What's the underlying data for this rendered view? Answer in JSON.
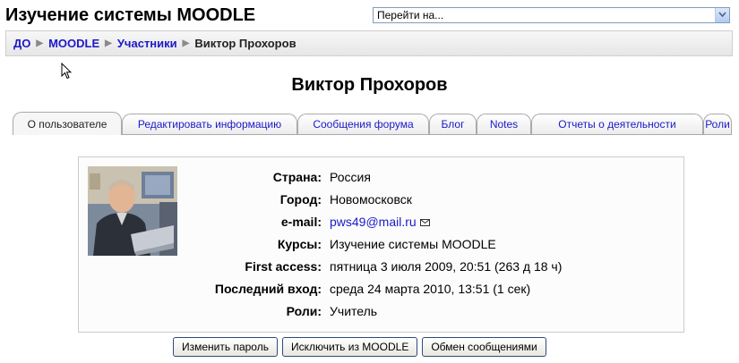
{
  "header": {
    "site_title": "Изучение системы MOODLE",
    "jump_menu": {
      "selected": "Перейти на..."
    }
  },
  "breadcrumb": {
    "items": [
      "ДО",
      "MOODLE",
      "Участники"
    ],
    "current": "Виктор Прохоров"
  },
  "page_title": "Виктор Прохоров",
  "tabs": [
    "О пользователе",
    "Редактировать информацию",
    "Сообщения форума",
    "Блог",
    "Notes",
    "Отчеты о деятельности",
    "Роли"
  ],
  "active_tab": "О пользователе",
  "profile": {
    "fields": [
      {
        "label": "Страна:",
        "value": "Россия"
      },
      {
        "label": "Город:",
        "value": "Новомосковск"
      },
      {
        "label": "e-mail:",
        "value": "pws49@mail.ru"
      },
      {
        "label": "Курсы:",
        "value": "Изучение системы MOODLE"
      },
      {
        "label": "First access:",
        "value": "пятница 3 июля 2009, 20:51  (263 д 18 ч)"
      },
      {
        "label": "Последний вход:",
        "value": "среда 24 марта 2010, 13:51  (1 сек)"
      },
      {
        "label": "Роли:",
        "value": "Учитель"
      }
    ]
  },
  "actions": {
    "change_password": "Изменить пароль",
    "unenrol": "Исключить из MOODLE",
    "messages": "Обмен сообщениями"
  },
  "colors": {
    "link": "#1c19c8",
    "border": "#aaaaaa"
  }
}
